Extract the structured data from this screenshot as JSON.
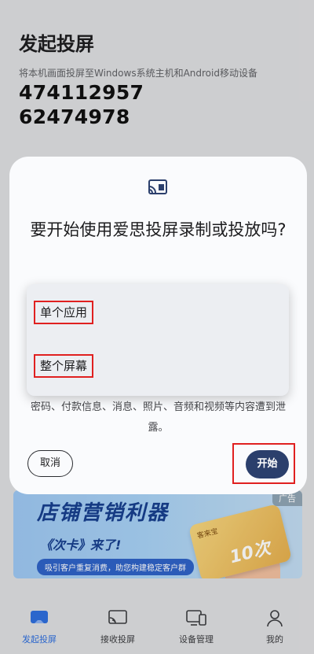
{
  "page": {
    "title": "发起投屏",
    "subtitle": "将本机画面投屏至Windows系统主机和Android移动设备",
    "code_line1": "474112957",
    "code_line2": "62474978"
  },
  "dialog": {
    "title": "要开始使用爱思投屏录制或投放吗?",
    "body": "密码、付款信息、消息、照片、音频和视频等内容遭到泄露。",
    "menu_items": [
      "单个应用",
      "整个屏幕"
    ],
    "cancel_label": "取消",
    "start_label": "开始"
  },
  "ad": {
    "title": "店铺营销利器",
    "line2": "《次卡》来了!",
    "pill": "吸引客户重复消费，助您构建稳定客户群",
    "tag": "广告",
    "card_number": "10次",
    "card_brand": "客来宝"
  },
  "nav": {
    "items": [
      {
        "label": "发起投屏",
        "icon": "cast-screen-icon",
        "active": true
      },
      {
        "label": "接收投屏",
        "icon": "receive-cast-icon",
        "active": false
      },
      {
        "label": "设备管理",
        "icon": "devices-icon",
        "active": false
      },
      {
        "label": "我的",
        "icon": "person-icon",
        "active": false
      }
    ]
  },
  "colors": {
    "accent": "#2f6fde",
    "start_button": "#2b3f6c",
    "highlight_frame": "#e02020"
  }
}
